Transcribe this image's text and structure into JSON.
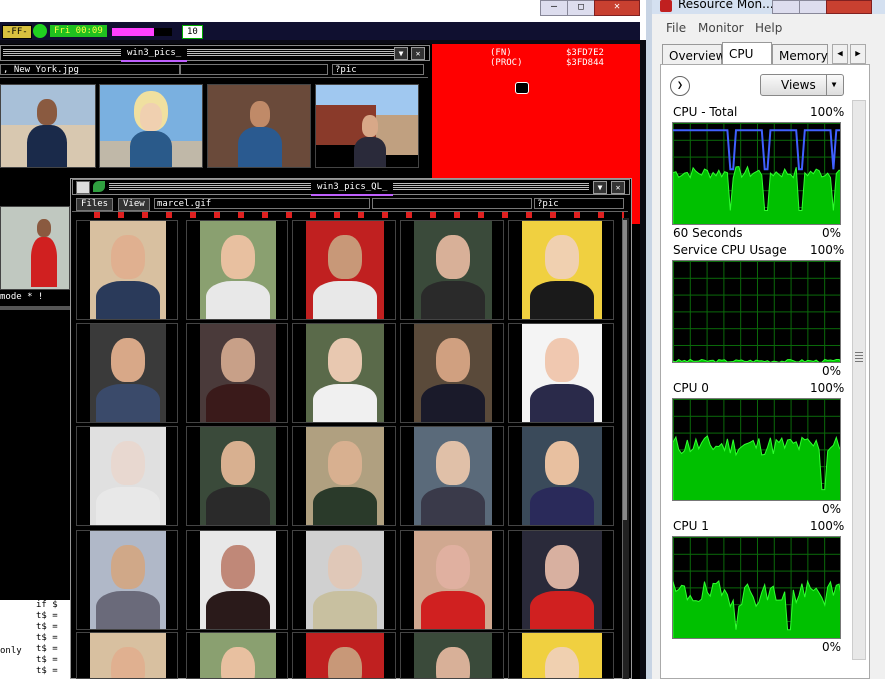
{
  "topbar": {
    "ff_label": "-FF-",
    "clock": "Fri 00:09",
    "counter": "10"
  },
  "background_window": {
    "title": "win3_pics_",
    "filename": ", New York.jpg",
    "search": "?pic",
    "info_fn_label": "(FN)",
    "info_fn_value": "$3FD7E2",
    "info_proc_label": "(PROC)",
    "info_proc_value": "$3FD844",
    "mode_text": "mode  *  !",
    "code_lines": [
      "if $",
      "t$ =",
      "t$ =",
      "t$ =",
      "t$ =",
      "t$ =",
      "t$ ="
    ],
    "only_text": "only"
  },
  "front_window": {
    "title": "win3_pics_QL_",
    "menu_files": "Files",
    "menu_view": "View",
    "filename": "marcel.gif",
    "search": "?pic"
  },
  "resource_monitor": {
    "title": "Resource Mon...",
    "menu": [
      "File",
      "Monitor",
      "Help"
    ],
    "tabs": [
      "Overview",
      "CPU",
      "Memory"
    ],
    "active_tab": "CPU",
    "views_button": "Views",
    "graphs": [
      {
        "label": "CPU - Total",
        "max": "100%",
        "min": "0%",
        "footer": "60 Seconds"
      },
      {
        "label": "Service CPU Usage",
        "max": "100%",
        "min": "0%",
        "footer": ""
      },
      {
        "label": "CPU 0",
        "max": "100%",
        "min": "0%",
        "footer": ""
      },
      {
        "label": "CPU 1",
        "max": "100%",
        "min": "0%",
        "footer": ""
      }
    ]
  },
  "colors": {
    "ql_red": "#ff0000",
    "graph_green": "#00c000",
    "graph_blue": "#4060ff",
    "title_purple": "#c060ff"
  }
}
